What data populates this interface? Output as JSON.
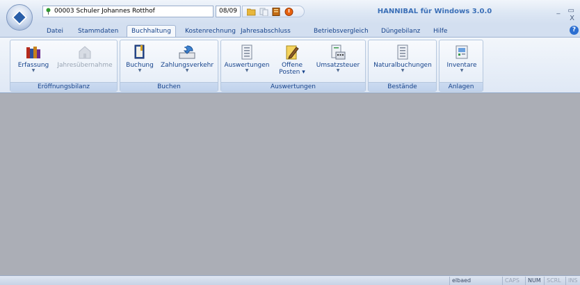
{
  "titlebar": {
    "mandant": "00003 Schuler Johannes Rotthof",
    "year": "08/09",
    "app_title": "HANNIBAL für Windows 3.0.0",
    "window_controls": "_ ▭ X"
  },
  "tabs": [
    "Datei",
    "Stammdaten",
    "Buchhaltung",
    "Kostenrechnung",
    "Jahresabschluss",
    "Betriebsvergleich",
    "Düngebilanz",
    "Hilfe"
  ],
  "active_tab": "Buchhaltung",
  "help_label": "?",
  "ribbon": {
    "groups": [
      {
        "label": "Eröffnungsbilanz",
        "buttons": [
          {
            "label": "Erfassung",
            "icon": "books-icon",
            "dropdown": true
          },
          {
            "label": "Jahresübernahme",
            "icon": "house-transfer-icon",
            "disabled": true
          }
        ]
      },
      {
        "label": "Buchen",
        "buttons": [
          {
            "label": "Buchung",
            "icon": "ledger-icon",
            "dropdown": true
          },
          {
            "label": "Zahlungsverkehr",
            "icon": "payment-icon",
            "dropdown": true
          }
        ]
      },
      {
        "label": "Auswertungen",
        "buttons": [
          {
            "label": "Auswertungen",
            "icon": "report-icon",
            "dropdown": true
          },
          {
            "label": "Offene",
            "label2": "Posten",
            "icon": "notepad-icon",
            "dropdown": true
          },
          {
            "label": "Umsatzsteuer",
            "icon": "tax-calc-icon",
            "dropdown": true
          }
        ]
      },
      {
        "label": "Bestände",
        "buttons": [
          {
            "label": "Naturalbuchungen",
            "icon": "stock-icon",
            "dropdown": true
          }
        ]
      },
      {
        "label": "Anlagen",
        "buttons": [
          {
            "label": "Inventare",
            "icon": "inventory-icon",
            "dropdown": true
          }
        ]
      }
    ]
  },
  "statusbar": {
    "user": "elbaed",
    "caps": "CAPS",
    "num": "NUM",
    "scrl": "SCRL",
    "ins": "INS"
  },
  "colors": {
    "accent": "#15428b",
    "workspace": "#abaeb6",
    "title": "#3a6fb7"
  }
}
